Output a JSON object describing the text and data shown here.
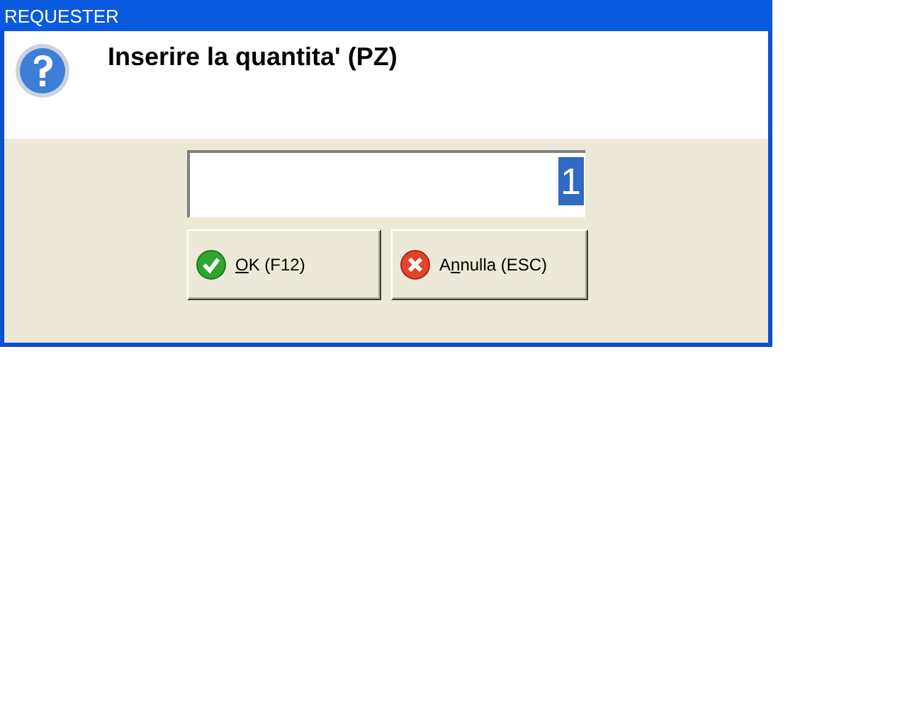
{
  "window": {
    "title": "REQUESTER"
  },
  "prompt": "Inserire la quantita' (PZ)",
  "field": {
    "value": "1",
    "selected": true
  },
  "buttons": [
    {
      "kind": "ok",
      "key": "O",
      "after": "K (F12)"
    },
    {
      "kind": "cancel",
      "before": "A",
      "key": "n",
      "after": "nulla (ESC)"
    }
  ]
}
